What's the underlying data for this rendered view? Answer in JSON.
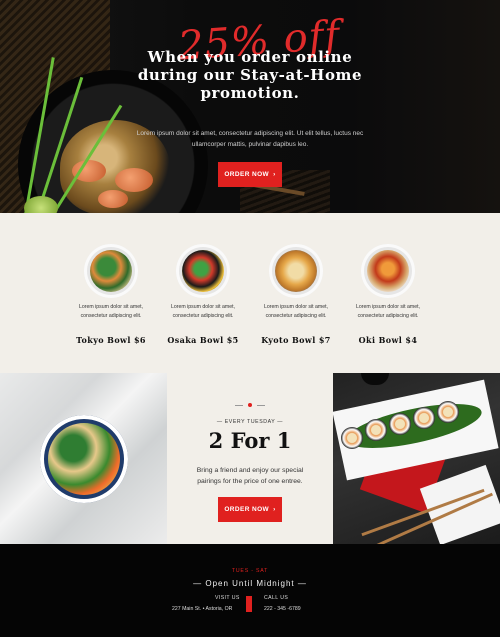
{
  "hero": {
    "promo_script": "25% off",
    "headline": "When you order online during our Stay-at-Home promotion.",
    "body": "Lorem ipsum dolor sit amet, consectetur adipiscing elit. Ut elit tellus, luctus nec ullamcorper mattis, pulvinar dapibus leo.",
    "button_label": "ORDER NOW",
    "button_icon": "›"
  },
  "menu": {
    "items": [
      {
        "desc": "Lorem ipsum dolor sit amet, consectetur adipiscing elit.",
        "name": "Tokyo Bowl $6"
      },
      {
        "desc": "Lorem ipsum dolor sit amet, consectetur adipiscing elit.",
        "name": "Osaka Bowl $5"
      },
      {
        "desc": "Lorem ipsum dolor sit amet, consectetur adipiscing elit.",
        "name": "Kyoto Bowl $7"
      },
      {
        "desc": "Lorem ipsum dolor sit amet, consectetur adipiscing elit.",
        "name": "Oki Bowl $4"
      }
    ]
  },
  "special": {
    "every": "— EVERY TUESDAY —",
    "title": "2 For 1",
    "body": "Bring a friend and enjoy our special pairings for the price of one entree.",
    "button_label": "ORDER NOW",
    "button_icon": "›"
  },
  "footer": {
    "days": "TUES - SAT",
    "open": "— Open Until Midnight —",
    "visit_label": "VISIT US",
    "visit_value": "227 Main St. • Astoria, OR",
    "call_label": "CALL US",
    "call_value": "222 - 345 -6789"
  },
  "colors": {
    "accent": "#e0211f",
    "cream": "#f2efe9",
    "dark": "#0a0a0a"
  }
}
